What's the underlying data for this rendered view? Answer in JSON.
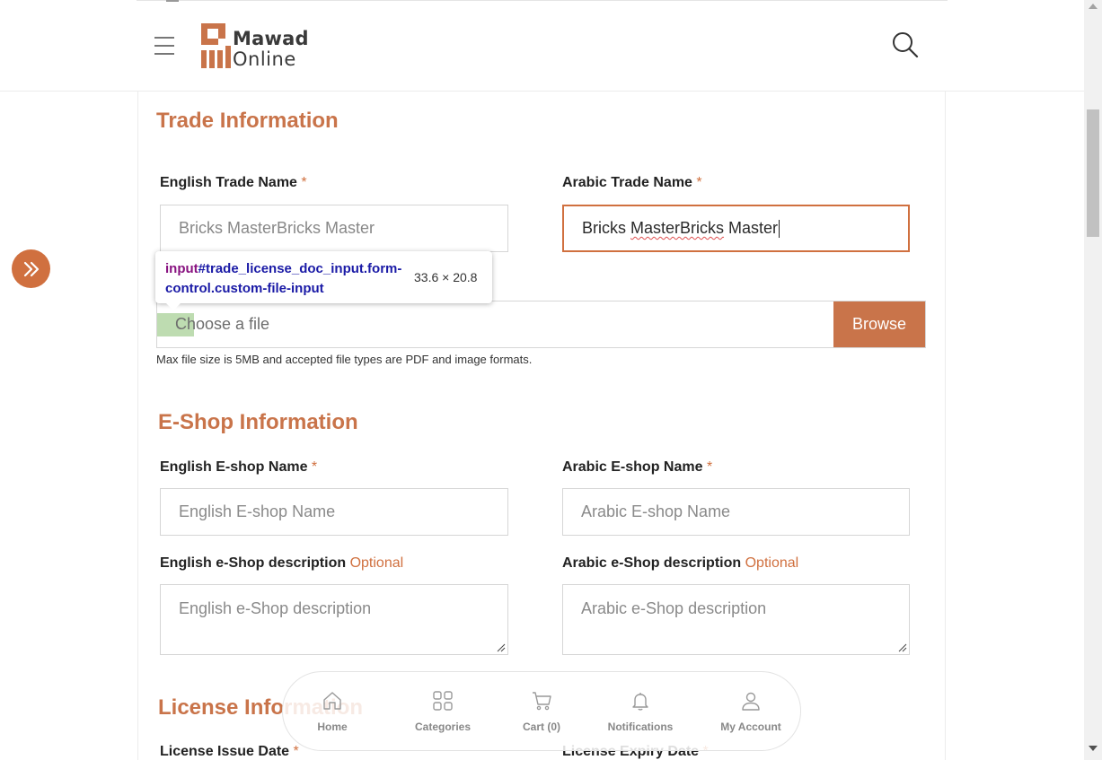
{
  "header": {
    "logo_line1": "Mawad",
    "logo_line2": "Online"
  },
  "trade": {
    "title": "Trade Information",
    "english_name_label": "English Trade Name",
    "english_name_value": "Bricks MasterBricks Master",
    "arabic_name_label": "Arabic Trade Name",
    "arabic_name_value_part1": "Bricks ",
    "arabic_name_value_part2": "MasterBricks",
    "arabic_name_value_part3": " Master",
    "file_placeholder": "Choose a file",
    "browse_label": "Browse",
    "file_help": "Max file size is 5MB and accepted file types are PDF and image formats."
  },
  "devtools_tooltip": {
    "selector_tag": "input",
    "selector_rest": "#trade_license_doc_input.form-control.custom-file-input",
    "dimensions": "33.6 × 20.8"
  },
  "eshop": {
    "title": "E-Shop Information",
    "english_name_label": "English E-shop Name",
    "english_name_placeholder": "English E-shop Name",
    "arabic_name_label": "Arabic E-shop Name",
    "arabic_name_placeholder": "Arabic E-shop Name",
    "english_desc_label": "English e-Shop description",
    "english_desc_placeholder": "English e-Shop description",
    "arabic_desc_label": "Arabic e-Shop description",
    "arabic_desc_placeholder": "Arabic e-Shop description",
    "optional": "Optional"
  },
  "license": {
    "title": "License Information",
    "issue_date_label": "License Issue Date",
    "expiry_date_label": "License Expiry Date"
  },
  "required_mark": "*",
  "bottom_nav": [
    {
      "label": "Home",
      "icon": "home-icon"
    },
    {
      "label": "Categories",
      "icon": "grid-icon"
    },
    {
      "label": "Cart (0)",
      "icon": "cart-icon"
    },
    {
      "label": "Notifications",
      "icon": "bell-icon"
    },
    {
      "label": "My Account",
      "icon": "user-icon"
    }
  ],
  "colors": {
    "accent": "#c9744a",
    "highlight": "#93c47d"
  }
}
